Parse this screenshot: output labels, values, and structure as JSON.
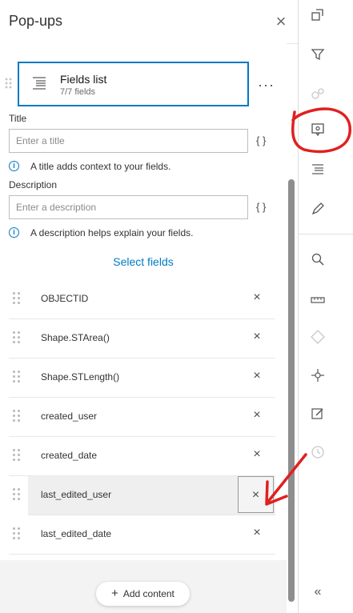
{
  "panel": {
    "title": "Pop-ups",
    "close_icon": "close-icon"
  },
  "card": {
    "title": "Fields list",
    "subtitle": "7/7 fields",
    "icon": "list-icon",
    "more": "···"
  },
  "title_field": {
    "label": "Title",
    "placeholder": "Enter a title",
    "expression_button": "{ }",
    "hint": "A title adds context to your fields."
  },
  "description_field": {
    "label": "Description",
    "placeholder": "Enter a description",
    "expression_button": "{ }",
    "hint": "A description helps explain your fields."
  },
  "select_fields_link": "Select fields",
  "fields": [
    {
      "name": "OBJECTID"
    },
    {
      "name": "Shape.STArea()"
    },
    {
      "name": "Shape.STLength()"
    },
    {
      "name": "created_user"
    },
    {
      "name": "created_date"
    },
    {
      "name": "last_edited_user"
    },
    {
      "name": "last_edited_date"
    }
  ],
  "active_field_index": 5,
  "remove_label": "×",
  "add_content": "Add content",
  "rail": {
    "buttons": [
      {
        "icon": "layer-properties-icon",
        "enabled": true
      },
      {
        "icon": "filter-icon",
        "enabled": true
      },
      {
        "icon": "cluster-icon",
        "enabled": false
      },
      {
        "icon": "popups-icon",
        "enabled": true,
        "active": true
      },
      {
        "icon": "fields-icon",
        "enabled": true
      },
      {
        "icon": "styles-icon",
        "enabled": true
      },
      {
        "icon": "search-icon",
        "enabled": true
      },
      {
        "icon": "measure-icon",
        "enabled": true
      },
      {
        "icon": "directions-icon",
        "enabled": false
      },
      {
        "icon": "location-icon",
        "enabled": true
      },
      {
        "icon": "sketch-icon",
        "enabled": true
      },
      {
        "icon": "time-icon",
        "enabled": false
      }
    ],
    "collapse_icon": "collapse-icon",
    "collapse_label": "«"
  },
  "colors": {
    "accent": "#007ac2",
    "annotation": "#e02020"
  }
}
